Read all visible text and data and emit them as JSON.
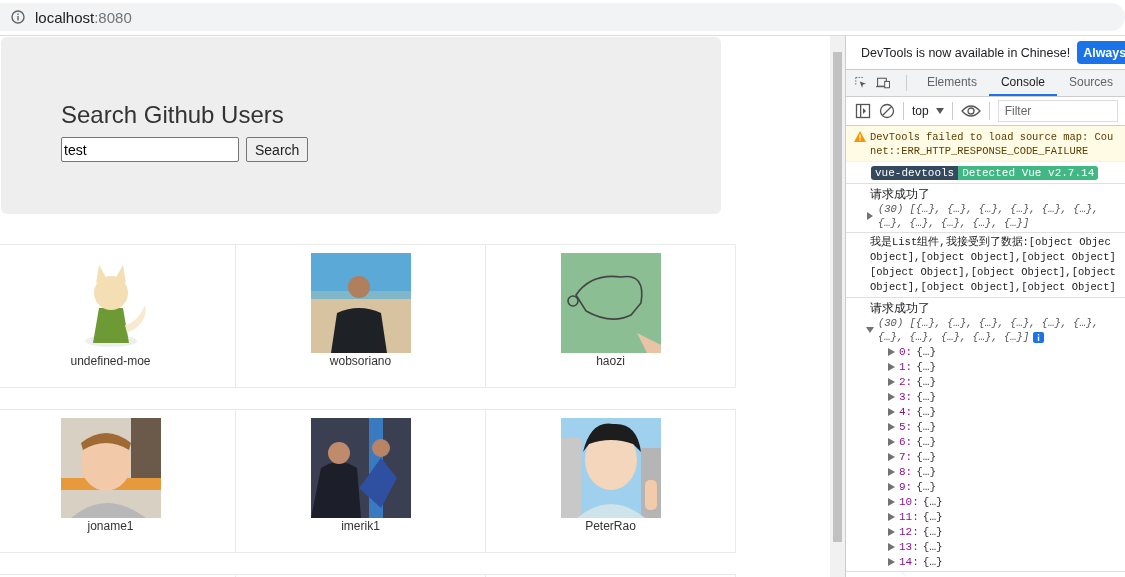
{
  "address_bar": {
    "host": "localhost",
    "port": ":8080"
  },
  "page": {
    "title": "Search Github Users",
    "search": {
      "value": "test"
    },
    "search_button": "Search",
    "users": [
      {
        "login": "undefined-moe",
        "kind": "picture"
      },
      {
        "login": "wobsoriano",
        "kind": "picture"
      },
      {
        "login": "haozi",
        "kind": "picture"
      },
      {
        "login": "joname1",
        "kind": "picture"
      },
      {
        "login": "imerik1",
        "kind": "picture"
      },
      {
        "login": "PeterRao",
        "kind": "picture"
      }
    ]
  },
  "devtools": {
    "notice": "DevTools is now available in Chinese!",
    "notice_button": "Always",
    "tabs": [
      {
        "label": "Elements",
        "selected": false
      },
      {
        "label": "Console",
        "selected": true
      },
      {
        "label": "Sources",
        "selected": false
      }
    ],
    "context": "top",
    "filter": {
      "placeholder": "Filter"
    },
    "messages": [
      {
        "kind": "warning",
        "lines": [
          "DevTools failed to load source map: Cou",
          "net::ERR_HTTP_RESPONSE_CODE_FAILURE"
        ]
      },
      {
        "kind": "badges",
        "labels": [
          "vue-devtools",
          "Detected Vue v2.7.14"
        ]
      },
      {
        "kind": "log",
        "lines": [
          "请求成功了"
        ],
        "array": {
          "expanded": false,
          "lines": [
            "(30) [{…}, {…}, {…}, {…}, {…}, {…},",
            "{…}, {…}, {…}, {…}, {…}]"
          ]
        }
      },
      {
        "kind": "log",
        "lines": [
          "我是List组件,我接受到了数据:[object Objec",
          "Object],[object Object],[object Object]",
          "[object Object],[object Object],[object",
          "Object],[object Object],[object Object]"
        ]
      },
      {
        "kind": "log",
        "lines": [
          "请求成功了"
        ],
        "array": {
          "expanded": true,
          "lines": [
            "(30) [{…}, {…}, {…}, {…}, {…}, {…},",
            "{…}, {…}, {…}, {…}, {…}]"
          ],
          "entries": [
            {
              "key": "0:",
              "value": "{…}"
            },
            {
              "key": "1:",
              "value": "{…}"
            },
            {
              "key": "2:",
              "value": "{…}"
            },
            {
              "key": "3:",
              "value": "{…}"
            },
            {
              "key": "4:",
              "value": "{…}"
            },
            {
              "key": "5:",
              "value": "{…}"
            },
            {
              "key": "6:",
              "value": "{…}"
            },
            {
              "key": "7:",
              "value": "{…}"
            },
            {
              "key": "8:",
              "value": "{…}"
            },
            {
              "key": "9:",
              "value": "{…}"
            },
            {
              "key": "10:",
              "value": "{…}"
            },
            {
              "key": "11:",
              "value": "{…}"
            },
            {
              "key": "12:",
              "value": "{…}"
            },
            {
              "key": "13:",
              "value": "{…}"
            },
            {
              "key": "14:",
              "value": "{…}"
            }
          ]
        }
      }
    ]
  }
}
